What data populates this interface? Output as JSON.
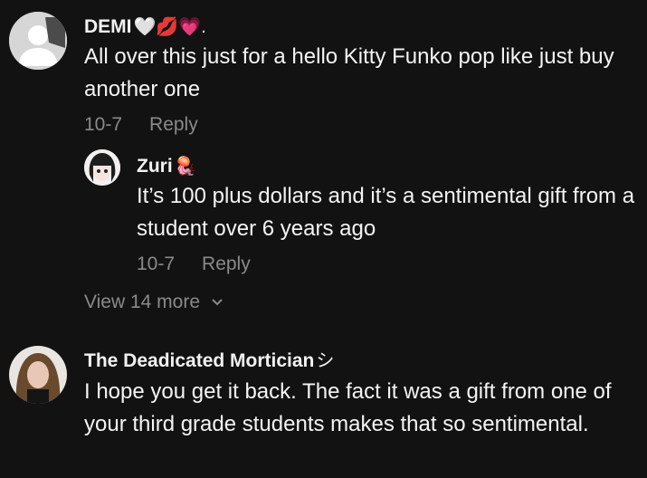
{
  "comments": [
    {
      "username": "DEMI",
      "emoji": "🤍💋💗.",
      "text": "All over this just for a hello Kitty Funko pop like just buy another one",
      "date": "10-7",
      "reply_label": "Reply",
      "reply": {
        "username": "Zuri",
        "emoji": "🪼",
        "text": "It’s 100 plus dollars and it’s a sentimental gift from a student over 6 years ago",
        "date": "10-7",
        "reply_label": "Reply"
      },
      "view_more_label": "View 14 more"
    },
    {
      "username": "The Deadicated Mortician",
      "emoji": "シ",
      "text": "I hope you get it back. The fact it was a gift from one of your third grade students makes that so sentimental."
    }
  ]
}
